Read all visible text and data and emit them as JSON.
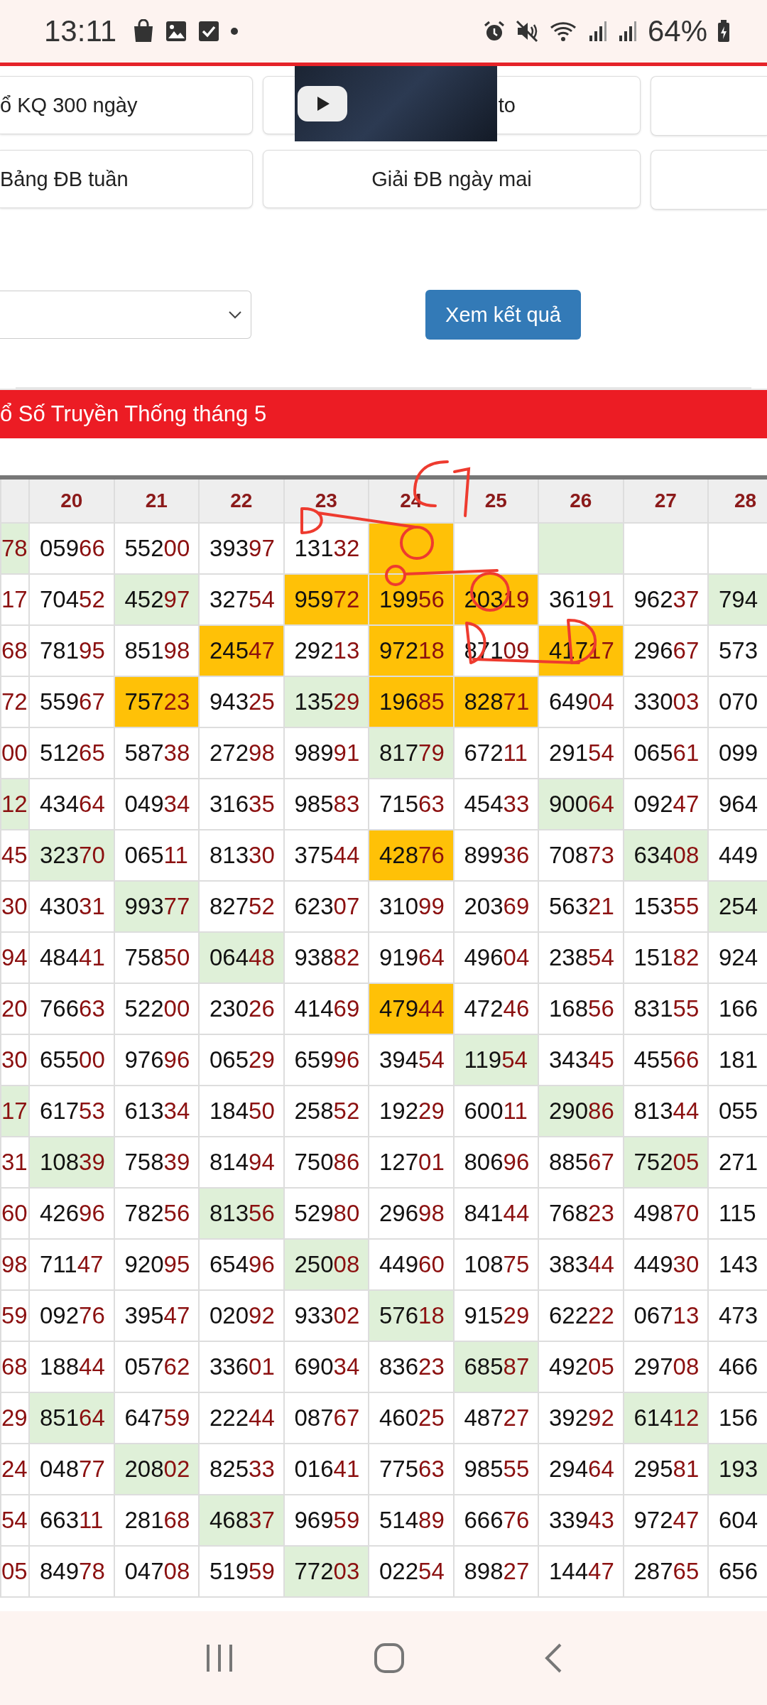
{
  "status_bar": {
    "time": "13:11",
    "battery": "64%"
  },
  "shortcut_rows": [
    [
      {
        "label": "ổ KQ 300 ngày"
      },
      {
        "label": "to"
      },
      {}
    ],
    [
      {
        "label": "Bảng ĐB tuần"
      },
      {
        "label": "Giải ĐB ngày mai"
      },
      {}
    ]
  ],
  "filter": {
    "button": "Xem kết quả"
  },
  "section_title": "ổ Số Truyền Thống tháng 5",
  "table": {
    "columns": [
      {
        "kind": "stub"
      },
      {
        "label": "20",
        "kind": "number"
      },
      {
        "label": "21",
        "kind": "number"
      },
      {
        "label": "22",
        "kind": "number"
      },
      {
        "label": "23",
        "kind": "number"
      },
      {
        "label": "24",
        "kind": "number"
      },
      {
        "label": "25",
        "kind": "number"
      },
      {
        "label": "26",
        "kind": "number"
      },
      {
        "label": "27",
        "kind": "number"
      },
      {
        "label": "28",
        "kind": "edge"
      }
    ],
    "rows": [
      [
        {
          "text": "78",
          "color": "#dff0d8"
        },
        {
          "text": "05966"
        },
        {
          "text": "55200"
        },
        {
          "text": "39397"
        },
        {
          "text": "13132"
        },
        {
          "color": "#ffc107"
        },
        {},
        {
          "color": "#dff0d8"
        },
        {},
        {}
      ],
      [
        {
          "text": "17"
        },
        {
          "text": "70452"
        },
        {
          "text": "45297",
          "color": "#dff0d8"
        },
        {
          "text": "32754"
        },
        {
          "text": "95972",
          "color": "#ffc107"
        },
        {
          "text": "19956",
          "color": "#ffc107"
        },
        {
          "text": "20319",
          "color": "#ffc107"
        },
        {
          "text": "36191"
        },
        {
          "text": "96237"
        },
        {
          "text": "794",
          "color": "#dff0d8"
        }
      ],
      [
        {
          "text": "68"
        },
        {
          "text": "78195"
        },
        {
          "text": "85198"
        },
        {
          "text": "24547",
          "color": "#ffc107"
        },
        {
          "text": "29213"
        },
        {
          "text": "97218",
          "color": "#ffc107"
        },
        {
          "text": "87109"
        },
        {
          "text": "41717",
          "color": "#ffc107"
        },
        {
          "text": "29667"
        },
        {
          "text": "573"
        }
      ],
      [
        {
          "text": "72"
        },
        {
          "text": "55967"
        },
        {
          "text": "75723",
          "color": "#ffc107"
        },
        {
          "text": "94325"
        },
        {
          "text": "13529",
          "color": "#dff0d8"
        },
        {
          "text": "19685",
          "color": "#ffc107"
        },
        {
          "text": "82871",
          "color": "#ffc107"
        },
        {
          "text": "64904"
        },
        {
          "text": "33003"
        },
        {
          "text": "070"
        }
      ],
      [
        {
          "text": "00"
        },
        {
          "text": "51265"
        },
        {
          "text": "58738"
        },
        {
          "text": "27298"
        },
        {
          "text": "98991"
        },
        {
          "text": "81779",
          "color": "#dff0d8"
        },
        {
          "text": "67211"
        },
        {
          "text": "29154"
        },
        {
          "text": "06561"
        },
        {
          "text": "099"
        }
      ],
      [
        {
          "text": "12",
          "color": "#dff0d8"
        },
        {
          "text": "43464"
        },
        {
          "text": "04934"
        },
        {
          "text": "31635"
        },
        {
          "text": "98583"
        },
        {
          "text": "71563"
        },
        {
          "text": "45433"
        },
        {
          "text": "90064",
          "color": "#dff0d8"
        },
        {
          "text": "09247"
        },
        {
          "text": "964"
        }
      ],
      [
        {
          "text": "45"
        },
        {
          "text": "32370",
          "color": "#dff0d8"
        },
        {
          "text": "06511"
        },
        {
          "text": "81330"
        },
        {
          "text": "37544"
        },
        {
          "text": "42876",
          "color": "#ffc107"
        },
        {
          "text": "89936"
        },
        {
          "text": "70873"
        },
        {
          "text": "63408",
          "color": "#dff0d8"
        },
        {
          "text": "449"
        }
      ],
      [
        {
          "text": "30"
        },
        {
          "text": "43031"
        },
        {
          "text": "99377",
          "color": "#dff0d8"
        },
        {
          "text": "82752"
        },
        {
          "text": "62307"
        },
        {
          "text": "31099"
        },
        {
          "text": "20369"
        },
        {
          "text": "56321"
        },
        {
          "text": "15355"
        },
        {
          "text": "254",
          "color": "#dff0d8"
        }
      ],
      [
        {
          "text": "94"
        },
        {
          "text": "48441"
        },
        {
          "text": "75850"
        },
        {
          "text": "06448",
          "color": "#dff0d8"
        },
        {
          "text": "93882"
        },
        {
          "text": "91964"
        },
        {
          "text": "49604"
        },
        {
          "text": "23854"
        },
        {
          "text": "15182"
        },
        {
          "text": "924"
        }
      ],
      [
        {
          "text": "20"
        },
        {
          "text": "76663"
        },
        {
          "text": "52200"
        },
        {
          "text": "23026"
        },
        {
          "text": "41469"
        },
        {
          "text": "47944",
          "color": "#ffc107"
        },
        {
          "text": "47246"
        },
        {
          "text": "16856"
        },
        {
          "text": "83155"
        },
        {
          "text": "166"
        }
      ],
      [
        {
          "text": "30"
        },
        {
          "text": "65500"
        },
        {
          "text": "97696"
        },
        {
          "text": "06529"
        },
        {
          "text": "65996"
        },
        {
          "text": "39454"
        },
        {
          "text": "11954",
          "color": "#dff0d8"
        },
        {
          "text": "34345"
        },
        {
          "text": "45566"
        },
        {
          "text": "181"
        }
      ],
      [
        {
          "text": "17",
          "color": "#dff0d8"
        },
        {
          "text": "61753"
        },
        {
          "text": "61334"
        },
        {
          "text": "18450"
        },
        {
          "text": "25852"
        },
        {
          "text": "19229"
        },
        {
          "text": "60011"
        },
        {
          "text": "29086",
          "color": "#dff0d8"
        },
        {
          "text": "81344"
        },
        {
          "text": "055"
        }
      ],
      [
        {
          "text": "31"
        },
        {
          "text": "10839",
          "color": "#dff0d8"
        },
        {
          "text": "75839"
        },
        {
          "text": "81494"
        },
        {
          "text": "75086"
        },
        {
          "text": "12701"
        },
        {
          "text": "80696"
        },
        {
          "text": "88567"
        },
        {
          "text": "75205",
          "color": "#dff0d8"
        },
        {
          "text": "271"
        }
      ],
      [
        {
          "text": "60"
        },
        {
          "text": "42696"
        },
        {
          "text": "78256"
        },
        {
          "text": "81356",
          "color": "#dff0d8"
        },
        {
          "text": "52980"
        },
        {
          "text": "29698"
        },
        {
          "text": "84144"
        },
        {
          "text": "76823"
        },
        {
          "text": "49870"
        },
        {
          "text": "115"
        }
      ],
      [
        {
          "text": "98"
        },
        {
          "text": "71147"
        },
        {
          "text": "92095"
        },
        {
          "text": "65496"
        },
        {
          "text": "25008",
          "color": "#dff0d8"
        },
        {
          "text": "44960"
        },
        {
          "text": "10875"
        },
        {
          "text": "38344"
        },
        {
          "text": "44930"
        },
        {
          "text": "143"
        }
      ],
      [
        {
          "text": "59"
        },
        {
          "text": "09276"
        },
        {
          "text": "39547"
        },
        {
          "text": "02092"
        },
        {
          "text": "93302"
        },
        {
          "text": "57618",
          "color": "#dff0d8"
        },
        {
          "text": "91529"
        },
        {
          "text": "62222"
        },
        {
          "text": "06713"
        },
        {
          "text": "473"
        }
      ],
      [
        {
          "text": "68"
        },
        {
          "text": "18844"
        },
        {
          "text": "05762"
        },
        {
          "text": "33601"
        },
        {
          "text": "69034"
        },
        {
          "text": "83623"
        },
        {
          "text": "68587",
          "color": "#dff0d8"
        },
        {
          "text": "49205"
        },
        {
          "text": "29708"
        },
        {
          "text": "466"
        }
      ],
      [
        {
          "text": "29"
        },
        {
          "text": "85164",
          "color": "#dff0d8"
        },
        {
          "text": "64759"
        },
        {
          "text": "22244"
        },
        {
          "text": "08767"
        },
        {
          "text": "46025"
        },
        {
          "text": "48727"
        },
        {
          "text": "39292"
        },
        {
          "text": "61412",
          "color": "#dff0d8"
        },
        {
          "text": "156"
        }
      ],
      [
        {
          "text": "24"
        },
        {
          "text": "04877"
        },
        {
          "text": "20802",
          "color": "#dff0d8"
        },
        {
          "text": "82533"
        },
        {
          "text": "01641"
        },
        {
          "text": "77563"
        },
        {
          "text": "98555"
        },
        {
          "text": "29464"
        },
        {
          "text": "29581"
        },
        {
          "text": "193",
          "color": "#dff0d8"
        }
      ],
      [
        {
          "text": "54"
        },
        {
          "text": "66311"
        },
        {
          "text": "28168"
        },
        {
          "text": "46837",
          "color": "#dff0d8"
        },
        {
          "text": "96959"
        },
        {
          "text": "51489"
        },
        {
          "text": "66676"
        },
        {
          "text": "33943"
        },
        {
          "text": "97247"
        },
        {
          "text": "604"
        }
      ],
      [
        {
          "text": "05"
        },
        {
          "text": "84978"
        },
        {
          "text": "04708"
        },
        {
          "text": "51959"
        },
        {
          "text": "77203",
          "color": "#dff0d8"
        },
        {
          "text": "02254"
        },
        {
          "text": "89827"
        },
        {
          "text": "14447"
        },
        {
          "text": "28765"
        },
        {
          "text": "656"
        }
      ]
    ]
  }
}
